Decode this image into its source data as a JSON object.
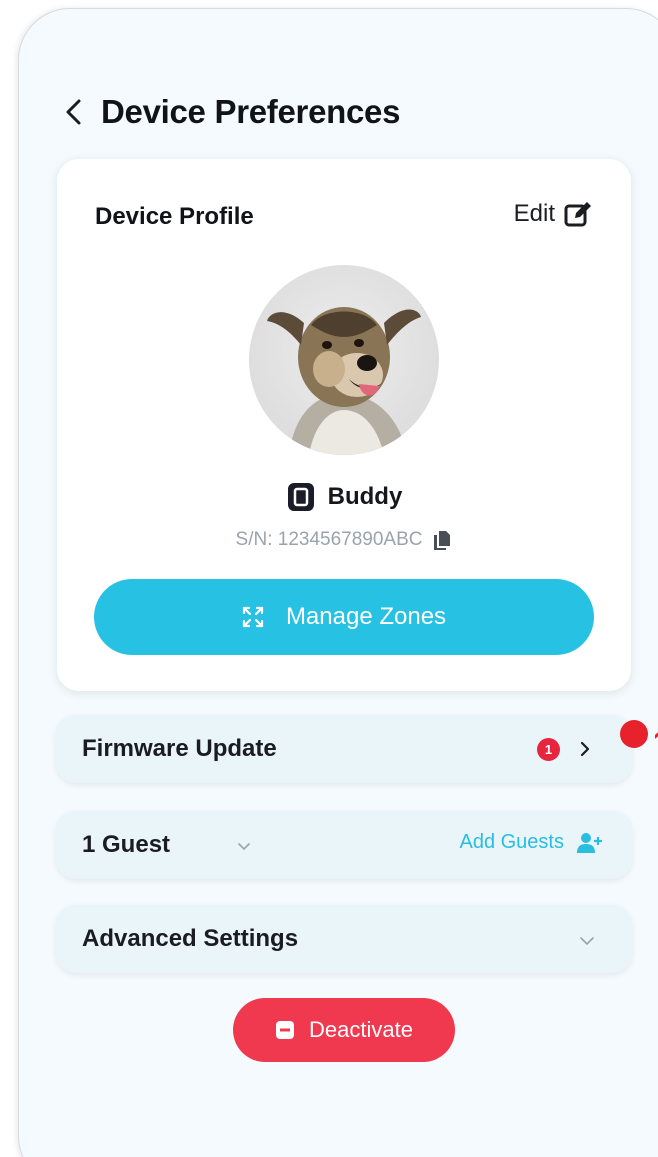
{
  "header": {
    "title": "Device Preferences"
  },
  "profile_card": {
    "title": "Device Profile",
    "edit_label": "Edit",
    "device_name": "Buddy",
    "serial": "S/N: 1234567890ABC",
    "manage_zones_label": "Manage Zones"
  },
  "firmware": {
    "label": "Firmware Update",
    "badge_count": "1"
  },
  "guests": {
    "label": "1 Guest",
    "add_label": "Add Guests"
  },
  "advanced": {
    "label": "Advanced Settings"
  },
  "deactivate": {
    "label": "Deactivate"
  },
  "colors": {
    "accent": "#27c1e3",
    "danger": "#f0394f",
    "badge": "#e8253e",
    "row_bg": "#eaf5fa",
    "page_bg": "#f4fafd"
  },
  "icons": [
    "chevron-left-icon",
    "edit-icon",
    "device-icon",
    "copy-icon",
    "expand-icon",
    "chevron-right-icon",
    "chevron-down-icon",
    "add-user-icon",
    "minus-square-icon"
  ]
}
